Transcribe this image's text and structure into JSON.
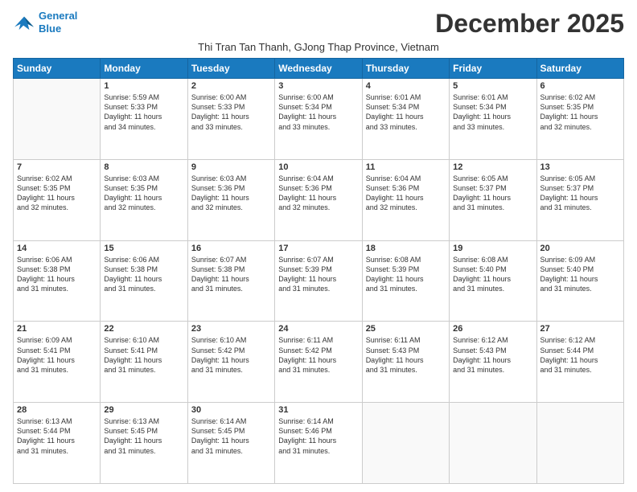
{
  "logo": {
    "line1": "General",
    "line2": "Blue"
  },
  "title": "December 2025",
  "subtitle": "Thi Tran Tan Thanh, GJong Thap Province, Vietnam",
  "headers": [
    "Sunday",
    "Monday",
    "Tuesday",
    "Wednesday",
    "Thursday",
    "Friday",
    "Saturday"
  ],
  "weeks": [
    [
      {
        "day": "",
        "info": ""
      },
      {
        "day": "1",
        "info": "Sunrise: 5:59 AM\nSunset: 5:33 PM\nDaylight: 11 hours\nand 34 minutes."
      },
      {
        "day": "2",
        "info": "Sunrise: 6:00 AM\nSunset: 5:33 PM\nDaylight: 11 hours\nand 33 minutes."
      },
      {
        "day": "3",
        "info": "Sunrise: 6:00 AM\nSunset: 5:34 PM\nDaylight: 11 hours\nand 33 minutes."
      },
      {
        "day": "4",
        "info": "Sunrise: 6:01 AM\nSunset: 5:34 PM\nDaylight: 11 hours\nand 33 minutes."
      },
      {
        "day": "5",
        "info": "Sunrise: 6:01 AM\nSunset: 5:34 PM\nDaylight: 11 hours\nand 33 minutes."
      },
      {
        "day": "6",
        "info": "Sunrise: 6:02 AM\nSunset: 5:35 PM\nDaylight: 11 hours\nand 32 minutes."
      }
    ],
    [
      {
        "day": "7",
        "info": "Sunrise: 6:02 AM\nSunset: 5:35 PM\nDaylight: 11 hours\nand 32 minutes."
      },
      {
        "day": "8",
        "info": "Sunrise: 6:03 AM\nSunset: 5:35 PM\nDaylight: 11 hours\nand 32 minutes."
      },
      {
        "day": "9",
        "info": "Sunrise: 6:03 AM\nSunset: 5:36 PM\nDaylight: 11 hours\nand 32 minutes."
      },
      {
        "day": "10",
        "info": "Sunrise: 6:04 AM\nSunset: 5:36 PM\nDaylight: 11 hours\nand 32 minutes."
      },
      {
        "day": "11",
        "info": "Sunrise: 6:04 AM\nSunset: 5:36 PM\nDaylight: 11 hours\nand 32 minutes."
      },
      {
        "day": "12",
        "info": "Sunrise: 6:05 AM\nSunset: 5:37 PM\nDaylight: 11 hours\nand 31 minutes."
      },
      {
        "day": "13",
        "info": "Sunrise: 6:05 AM\nSunset: 5:37 PM\nDaylight: 11 hours\nand 31 minutes."
      }
    ],
    [
      {
        "day": "14",
        "info": "Sunrise: 6:06 AM\nSunset: 5:38 PM\nDaylight: 11 hours\nand 31 minutes."
      },
      {
        "day": "15",
        "info": "Sunrise: 6:06 AM\nSunset: 5:38 PM\nDaylight: 11 hours\nand 31 minutes."
      },
      {
        "day": "16",
        "info": "Sunrise: 6:07 AM\nSunset: 5:38 PM\nDaylight: 11 hours\nand 31 minutes."
      },
      {
        "day": "17",
        "info": "Sunrise: 6:07 AM\nSunset: 5:39 PM\nDaylight: 11 hours\nand 31 minutes."
      },
      {
        "day": "18",
        "info": "Sunrise: 6:08 AM\nSunset: 5:39 PM\nDaylight: 11 hours\nand 31 minutes."
      },
      {
        "day": "19",
        "info": "Sunrise: 6:08 AM\nSunset: 5:40 PM\nDaylight: 11 hours\nand 31 minutes."
      },
      {
        "day": "20",
        "info": "Sunrise: 6:09 AM\nSunset: 5:40 PM\nDaylight: 11 hours\nand 31 minutes."
      }
    ],
    [
      {
        "day": "21",
        "info": "Sunrise: 6:09 AM\nSunset: 5:41 PM\nDaylight: 11 hours\nand 31 minutes."
      },
      {
        "day": "22",
        "info": "Sunrise: 6:10 AM\nSunset: 5:41 PM\nDaylight: 11 hours\nand 31 minutes."
      },
      {
        "day": "23",
        "info": "Sunrise: 6:10 AM\nSunset: 5:42 PM\nDaylight: 11 hours\nand 31 minutes."
      },
      {
        "day": "24",
        "info": "Sunrise: 6:11 AM\nSunset: 5:42 PM\nDaylight: 11 hours\nand 31 minutes."
      },
      {
        "day": "25",
        "info": "Sunrise: 6:11 AM\nSunset: 5:43 PM\nDaylight: 11 hours\nand 31 minutes."
      },
      {
        "day": "26",
        "info": "Sunrise: 6:12 AM\nSunset: 5:43 PM\nDaylight: 11 hours\nand 31 minutes."
      },
      {
        "day": "27",
        "info": "Sunrise: 6:12 AM\nSunset: 5:44 PM\nDaylight: 11 hours\nand 31 minutes."
      }
    ],
    [
      {
        "day": "28",
        "info": "Sunrise: 6:13 AM\nSunset: 5:44 PM\nDaylight: 11 hours\nand 31 minutes."
      },
      {
        "day": "29",
        "info": "Sunrise: 6:13 AM\nSunset: 5:45 PM\nDaylight: 11 hours\nand 31 minutes."
      },
      {
        "day": "30",
        "info": "Sunrise: 6:14 AM\nSunset: 5:45 PM\nDaylight: 11 hours\nand 31 minutes."
      },
      {
        "day": "31",
        "info": "Sunrise: 6:14 AM\nSunset: 5:46 PM\nDaylight: 11 hours\nand 31 minutes."
      },
      {
        "day": "",
        "info": ""
      },
      {
        "day": "",
        "info": ""
      },
      {
        "day": "",
        "info": ""
      }
    ]
  ]
}
